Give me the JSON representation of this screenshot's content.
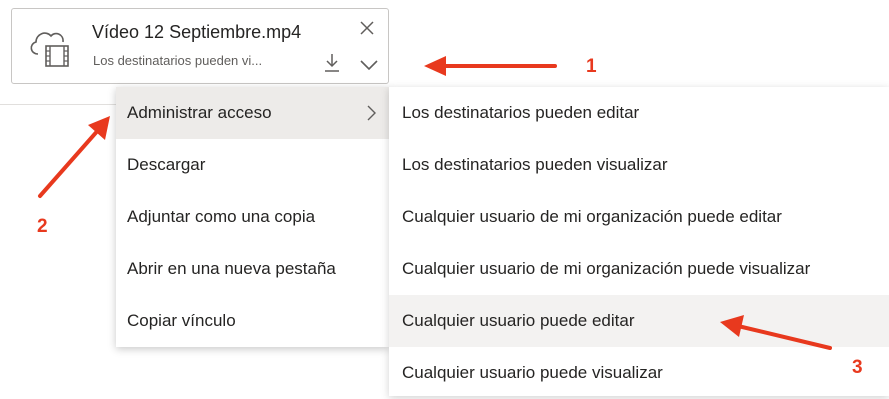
{
  "attachment": {
    "file_name": "Vídeo 12 Septiembre.mp4",
    "permission_summary": "Los destinatarios pueden vi...",
    "icon": "cloud-video-file-icon",
    "actions": [
      "close-icon",
      "download-icon",
      "chevron-down-icon"
    ]
  },
  "context_menu": {
    "items": [
      {
        "label": "Administrar acceso",
        "has_submenu": true,
        "active": true
      },
      {
        "label": "Descargar"
      },
      {
        "label": "Adjuntar como una copia"
      },
      {
        "label": "Abrir en una nueva pestaña"
      },
      {
        "label": "Copiar vínculo"
      }
    ]
  },
  "submenu": {
    "items": [
      {
        "label": "Los destinatarios pueden editar"
      },
      {
        "label": "Los destinatarios pueden visualizar"
      },
      {
        "label": "Cualquier usuario de mi organización puede editar"
      },
      {
        "label": "Cualquier usuario de mi organización puede visualizar"
      },
      {
        "label": "Cualquier usuario puede editar",
        "highlighted": true
      },
      {
        "label": "Cualquier usuario puede visualizar"
      }
    ]
  },
  "annotations": {
    "colors": {
      "arrow": "#e8391e"
    },
    "labels": [
      "1",
      "2",
      "3"
    ]
  }
}
